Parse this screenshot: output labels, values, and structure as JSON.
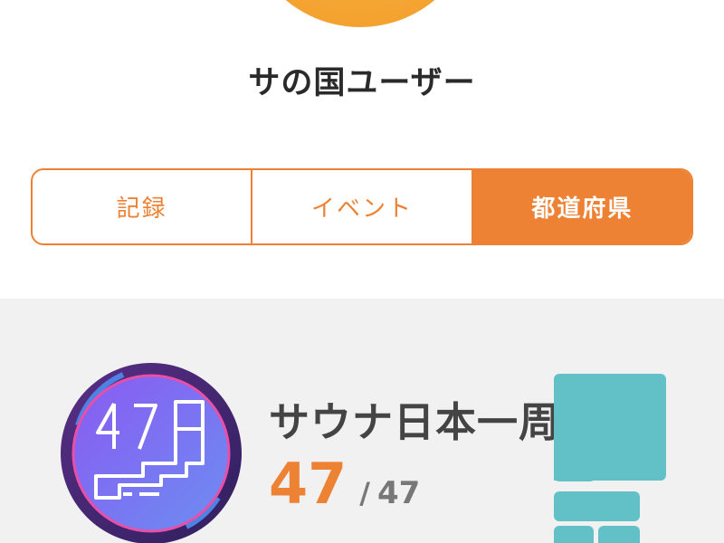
{
  "profile": {
    "username": "サの国ユーザー",
    "avatar_color": "#f6ab35"
  },
  "tabs": [
    {
      "label": "記録",
      "active": false
    },
    {
      "label": "イベント",
      "active": false
    },
    {
      "label": "都道府県",
      "active": true
    }
  ],
  "colors": {
    "accent": "#ee8234",
    "map_tile": "#62c1c6",
    "section_bg": "#f1f1f1"
  },
  "achievement": {
    "badge_number": "47",
    "badge_icon": "japan-map-badge-icon",
    "title": "サウナ日本一周",
    "current": "47",
    "separator": "/",
    "total": "47"
  }
}
